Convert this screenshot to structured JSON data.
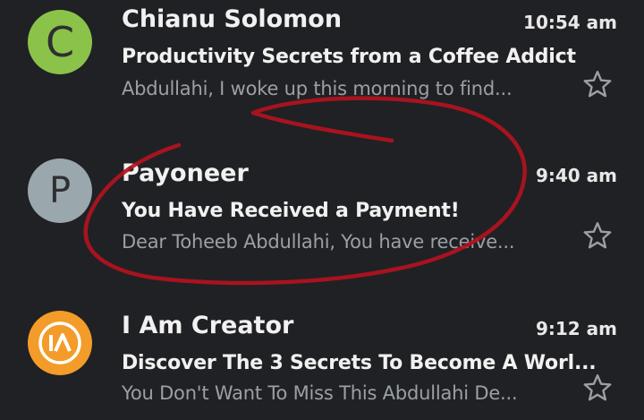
{
  "emails": [
    {
      "avatar_letter": "C",
      "avatar_color": "#8bc34a",
      "sender": "Chianu Solomon",
      "time": "10:54 am",
      "subject": "Productivity Secrets from a Coffee Addict",
      "snippet": "Abdullahi, I woke up this morning to find...",
      "starred": false
    },
    {
      "avatar_letter": "P",
      "avatar_color": "#9aa7ad",
      "sender": "Payoneer",
      "time": "9:40 am",
      "subject": "You Have Received a Payment!",
      "snippet": "Dear Toheeb Abdullahi, You have receive...",
      "starred": false
    },
    {
      "avatar_color": "#f39c29",
      "sender": "I Am Creator",
      "time": "9:12 am",
      "subject": "Discover The 3 Secrets To Become A Worl...",
      "snippet": "You Don't Want To Miss This Abdullahi De...",
      "starred": false
    }
  ],
  "colors": {
    "background": "#202124",
    "annotation": "#b3121f"
  },
  "icons": {
    "star": "star-outline-icon",
    "logo": "ia-logo-icon"
  }
}
